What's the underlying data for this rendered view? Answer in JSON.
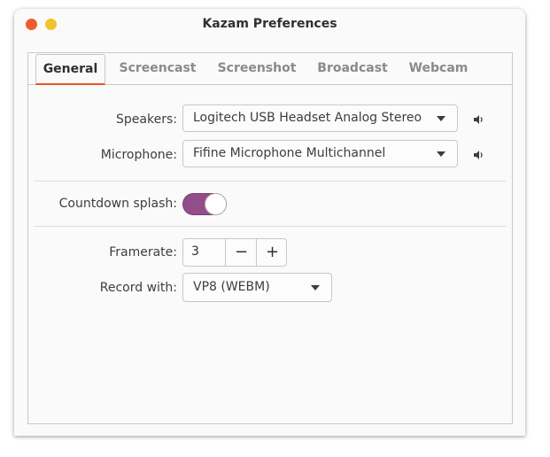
{
  "window": {
    "title": "Kazam Preferences"
  },
  "tabs": [
    {
      "label": "General",
      "active": true
    },
    {
      "label": "Screencast",
      "active": false
    },
    {
      "label": "Screenshot",
      "active": false
    },
    {
      "label": "Broadcast",
      "active": false
    },
    {
      "label": "Webcam",
      "active": false
    }
  ],
  "general": {
    "speakers": {
      "label": "Speakers:",
      "value": "Logitech USB Headset Analog Stereo",
      "icon": "speaker-icon"
    },
    "microphone": {
      "label": "Microphone:",
      "value": "Fifine Microphone Multichannel",
      "icon": "speaker-icon"
    },
    "countdown": {
      "label": "Countdown splash:",
      "enabled": true
    },
    "framerate": {
      "label": "Framerate:",
      "value": "3",
      "decrement": "−",
      "increment": "+"
    },
    "record_with": {
      "label": "Record with:",
      "value": "VP8 (WEBM)"
    }
  },
  "colors": {
    "close_button": "#ee5c30",
    "minimize_button": "#f3c32b",
    "active_tab_underline": "#e95420",
    "switch_on": "#924d8b"
  }
}
